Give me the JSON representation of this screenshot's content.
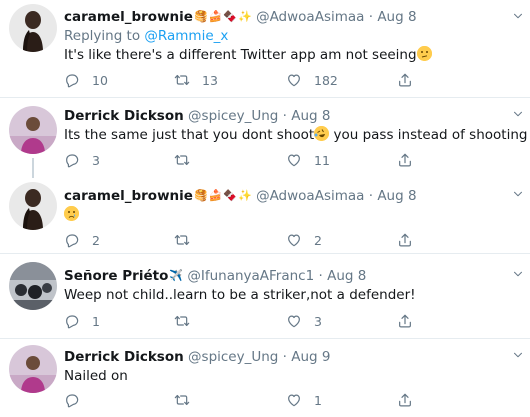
{
  "tweets": [
    {
      "name": "caramel_brownie",
      "handle": "@AdwoaAsimaa",
      "dot": "·",
      "date": "Aug 8",
      "replying_label": "Replying to",
      "replying_handle": "@Rammie_x",
      "text": "It's like there's a different Twitter app am not seeing",
      "text_emoji": "confused-face",
      "name_emojis": [
        "🥞",
        "🍰",
        "🍫",
        "✨"
      ],
      "replies": "10",
      "retweets": "13",
      "likes": "182"
    },
    {
      "name": "Derrick Dickson",
      "handle": "@spicey_Ung",
      "dot": "·",
      "date": "Aug 8",
      "text_before": "Its the same just that you dont shoot",
      "text_after": " you pass instead of shooting",
      "text_emoji": "rolling-on-floor-laughing-face",
      "replies": "3",
      "retweets": "",
      "likes": "11"
    },
    {
      "name": "caramel_brownie",
      "handle": "@AdwoaAsimaa",
      "dot": "·",
      "date": "Aug 8",
      "text_emoji": "crying-face",
      "name_emojis": [
        "🥞",
        "🍰",
        "🍫",
        "✨"
      ],
      "replies": "2",
      "retweets": "",
      "likes": "2"
    },
    {
      "name": "Señore Priéto",
      "handle": "@IfunanyaAFranc1",
      "dot": "·",
      "date": "Aug 8",
      "name_emoji": "✈️",
      "text": "Weep not child..learn to be a striker,not a defender!",
      "replies": "1",
      "retweets": "",
      "likes": "3"
    },
    {
      "name": "Derrick Dickson",
      "handle": "@spicey_Ung",
      "dot": "·",
      "date": "Aug 9",
      "text": "Nailed on",
      "replies": "",
      "retweets": "",
      "likes": "1"
    }
  ],
  "colors": {
    "text": "#14171a",
    "muted": "#657786",
    "link": "#1da1f2",
    "divider": "#e6ecf0",
    "thread": "#ccd6dd",
    "emoji_yellow": "#ffcc4d"
  },
  "icons": [
    "reply-icon",
    "retweet-icon",
    "like-icon",
    "share-icon",
    "chevron-down-icon"
  ]
}
